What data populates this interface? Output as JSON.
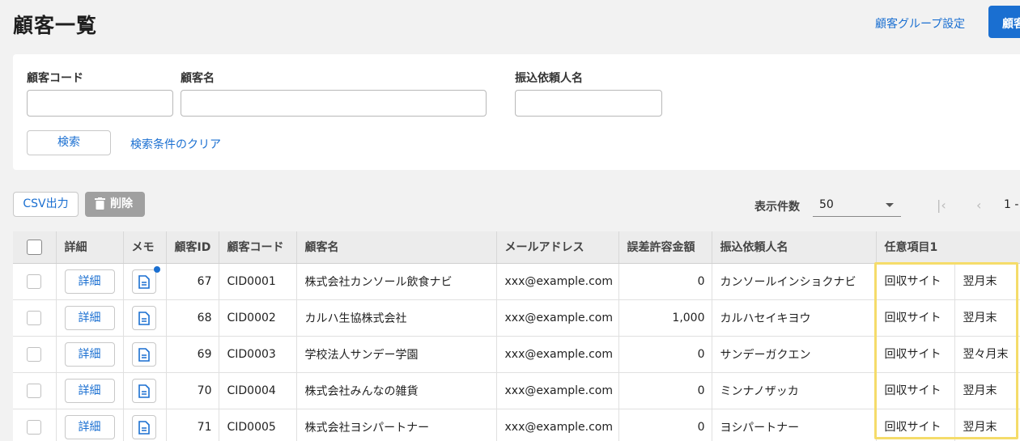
{
  "header": {
    "title": "顧客一覧",
    "group_link": "顧客グループ設定",
    "primary_button": "顧客"
  },
  "search": {
    "customer_code_label": "顧客コード",
    "customer_name_label": "顧客名",
    "transfer_name_label": "振込依頼人名",
    "customer_code_value": "",
    "customer_name_value": "",
    "transfer_name_value": "",
    "search_button": "検索",
    "clear_link": "検索条件のクリア"
  },
  "toolbar": {
    "csv_button": "CSV出力",
    "delete_button": "削除",
    "per_page_label": "表示件数",
    "per_page_value": "50",
    "range_text": "1 -"
  },
  "colors": {
    "accent": "#1a6fd1",
    "highlight": "#f5dc6a",
    "disabled": "#a0a0a0"
  },
  "table": {
    "headers": {
      "detail": "詳細",
      "memo": "メモ",
      "id": "顧客ID",
      "code": "顧客コード",
      "name": "顧客名",
      "email": "メールアドレス",
      "tolerance": "誤差許容金額",
      "transfer_name": "振込依頼人名",
      "custom1": "任意項目1"
    },
    "detail_label": "詳細",
    "rows": [
      {
        "id": "67",
        "code": "CID0001",
        "name": "株式会社カンソール飲食ナビ",
        "email": "xxx@example.com",
        "tolerance": "0",
        "transfer_name": "カンソールインショクナビ",
        "custom_key": "回収サイト",
        "custom_val": "翌月末",
        "has_memo": true
      },
      {
        "id": "68",
        "code": "CID0002",
        "name": "カルハ生協株式会社",
        "email": "xxx@example.com",
        "tolerance": "1,000",
        "transfer_name": "カルハセイキヨウ",
        "custom_key": "回収サイト",
        "custom_val": "翌月末",
        "has_memo": false
      },
      {
        "id": "69",
        "code": "CID0003",
        "name": "学校法人サンデー学園",
        "email": "xxx@example.com",
        "tolerance": "0",
        "transfer_name": "サンデーガクエン",
        "custom_key": "回収サイト",
        "custom_val": "翌々月末",
        "has_memo": false
      },
      {
        "id": "70",
        "code": "CID0004",
        "name": "株式会社みんなの雑貨",
        "email": "xxx@example.com",
        "tolerance": "0",
        "transfer_name": "ミンナノザッカ",
        "custom_key": "回収サイト",
        "custom_val": "翌月末",
        "has_memo": false
      },
      {
        "id": "71",
        "code": "CID0005",
        "name": "株式会社ヨシパートナー",
        "email": "xxx@example.com",
        "tolerance": "0",
        "transfer_name": "ヨシパートナー",
        "custom_key": "回収サイト",
        "custom_val": "翌月末",
        "has_memo": false
      }
    ]
  }
}
